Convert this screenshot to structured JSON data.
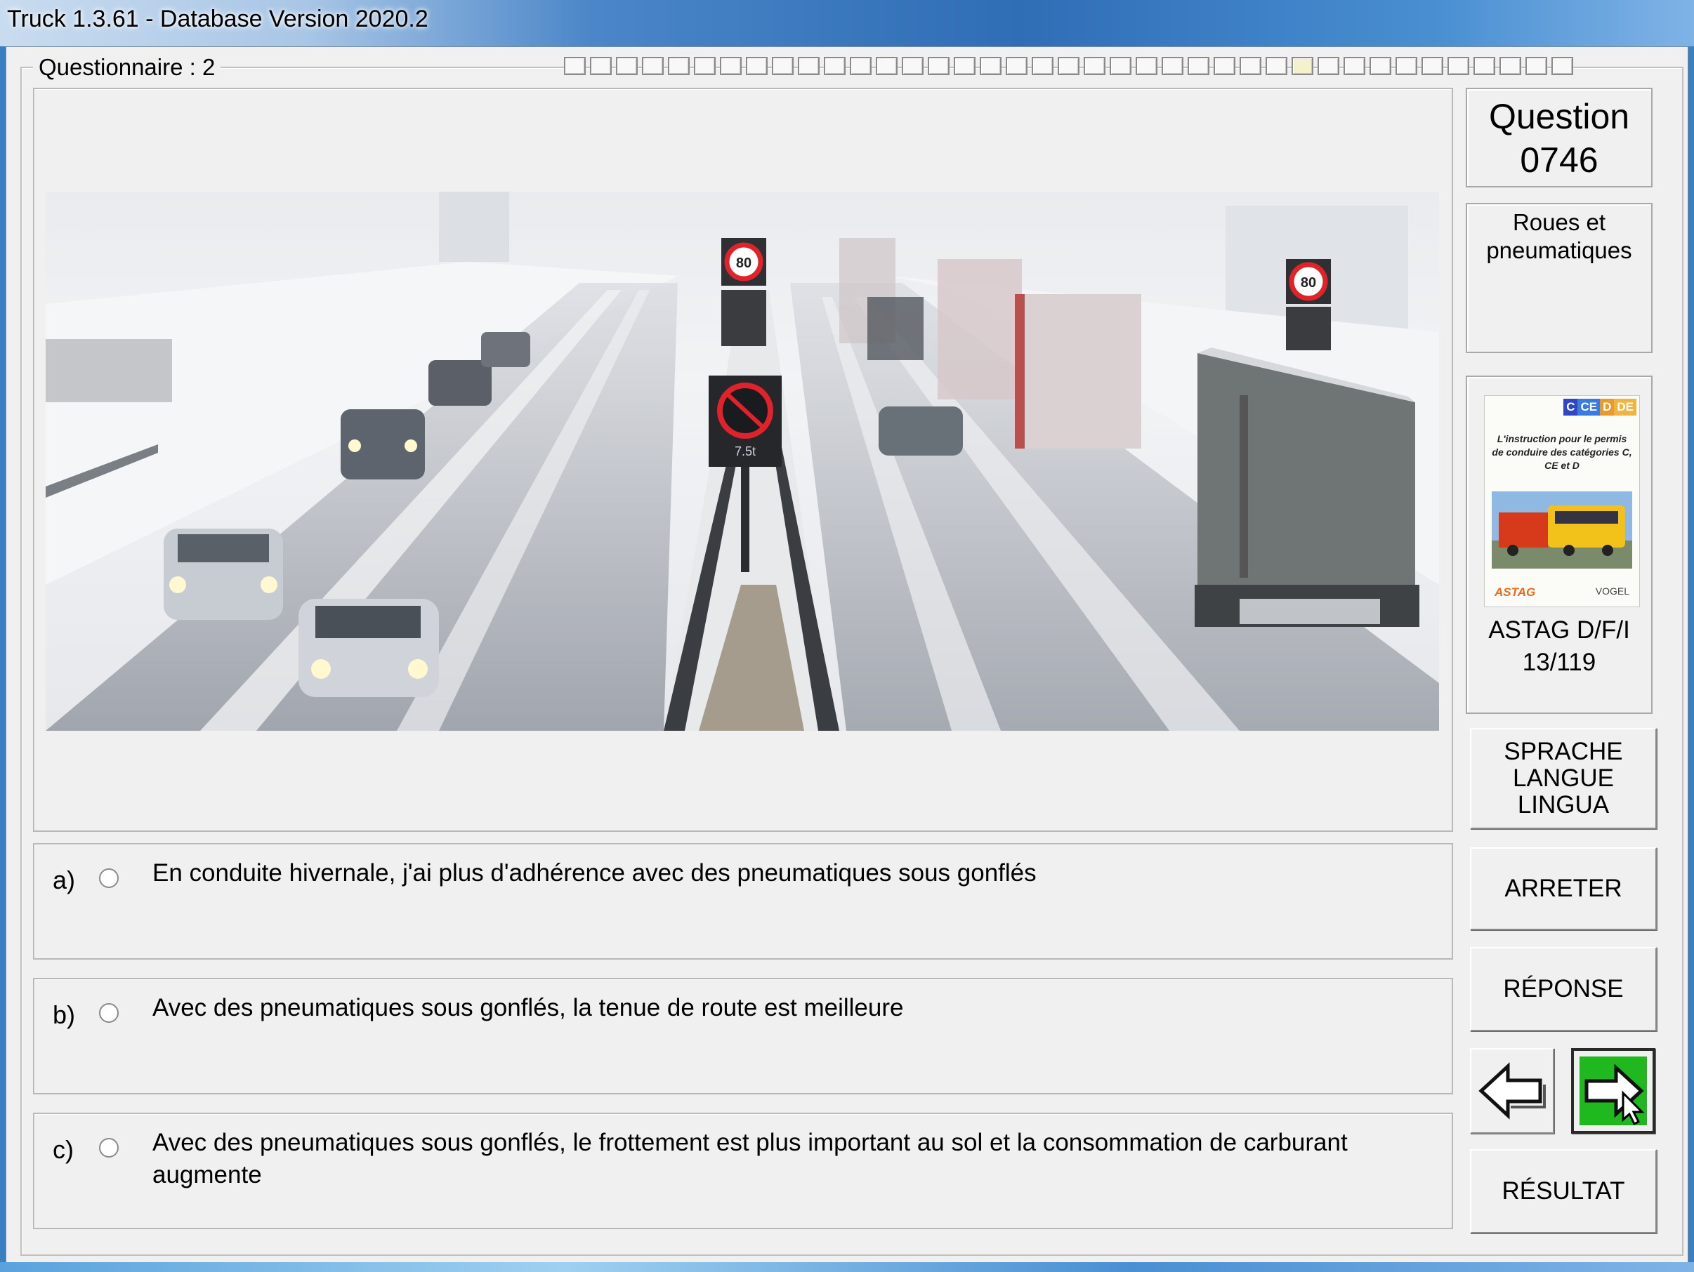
{
  "window": {
    "title": "Truck 1.3.61 - Database Version 2020.2"
  },
  "questionnaire": {
    "label": "Questionnaire : 2",
    "progress_total": 39,
    "progress_current": 28
  },
  "question": {
    "label": "Question",
    "number": "0746",
    "category": "Roues et pneumatiques",
    "image_alt": "Autoroute enneigée avec voitures et camions"
  },
  "answers": [
    {
      "letter": "a)",
      "text": "En conduite hivernale, j'ai plus d'adhérence avec des pneumatiques sous gonflés"
    },
    {
      "letter": "b)",
      "text": "Avec des pneumatiques sous gonflés, la tenue de route est meilleure"
    },
    {
      "letter": "c)",
      "text": "Avec des pneumatiques sous gonflés, le frottement est plus important au sol et la consommation de carburant augmente"
    }
  ],
  "book": {
    "tags": [
      "C",
      "CE",
      "D",
      "DE"
    ],
    "subtitle": "L'instruction pour le permis de conduire des catégories C, CE et D",
    "logo_left": "ASTAG",
    "logo_right": "VOGEL",
    "source": "ASTAG D/F/I",
    "page": "13/119"
  },
  "buttons": {
    "language_lines": [
      "SPRACHE",
      "LANGUE",
      "LINGUA"
    ],
    "stop": "ARRETER",
    "answer": "RÉPONSE",
    "result": "RÉSULTAT"
  },
  "signs": {
    "speed_left": "80",
    "speed_right": "80",
    "plate": "7.5t"
  },
  "colors": {
    "next_button": "#1fb81f",
    "sign_red": "#e0222a"
  }
}
